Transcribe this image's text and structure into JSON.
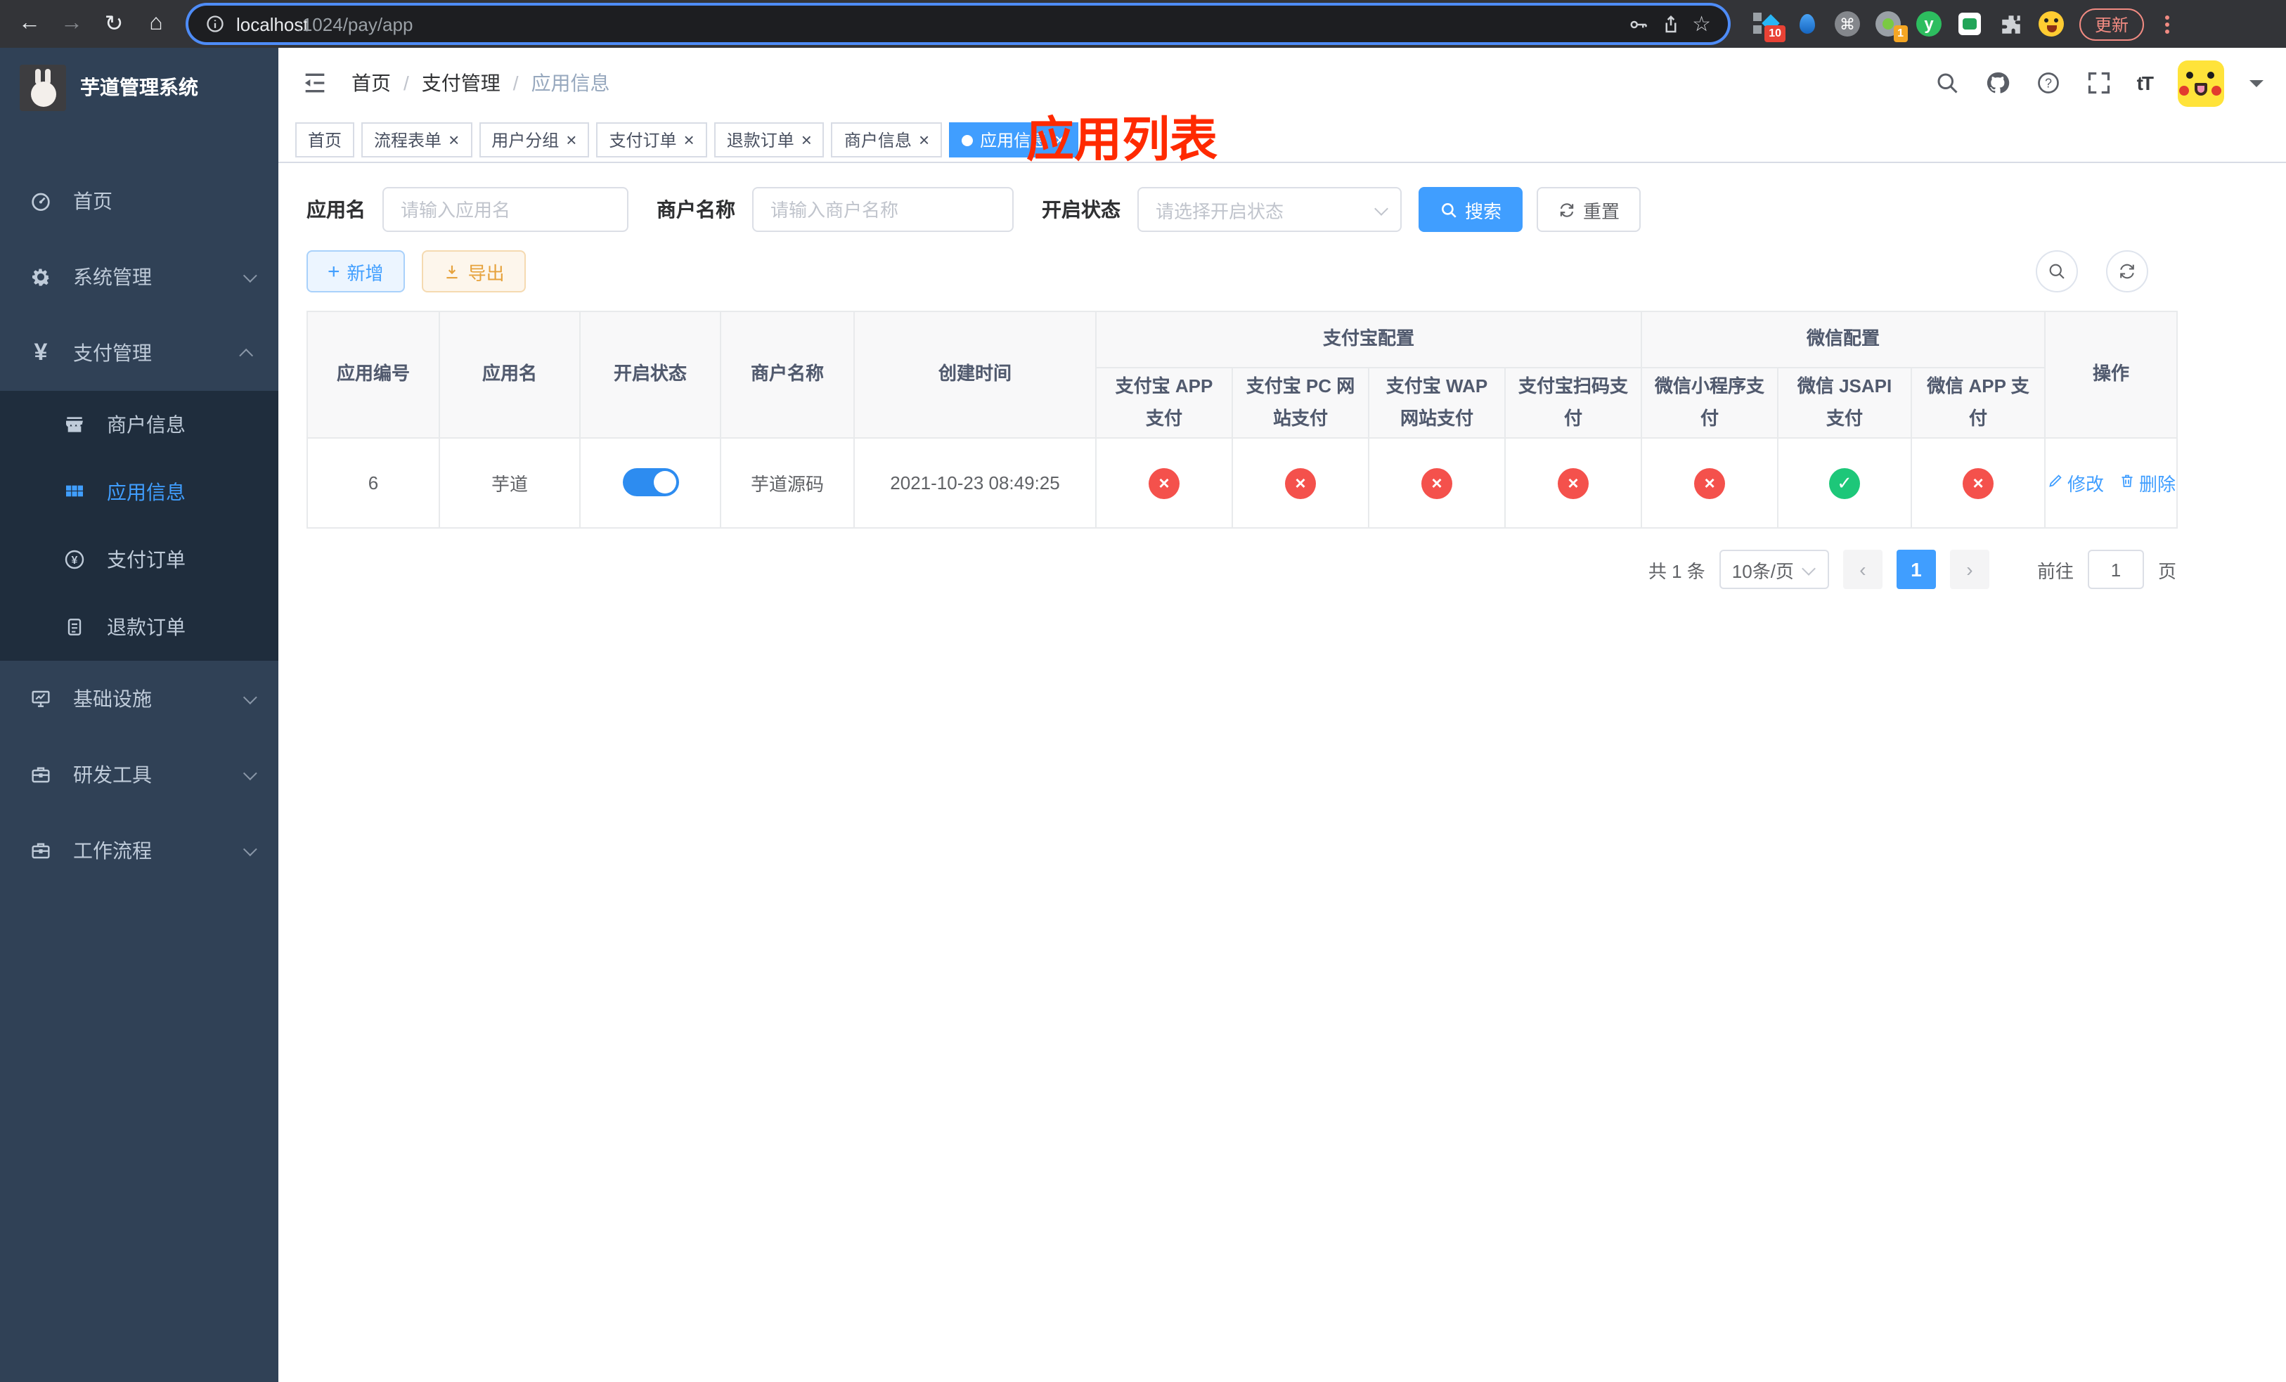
{
  "colors": {
    "accent": "#409eff",
    "danger": "#f4514c",
    "success": "#1dc779",
    "toggle_on": "#2d8cf0",
    "annotation_red": "#ff2a00"
  },
  "browser": {
    "url_host": "localhost",
    "url_rest": ":1024/pay/app",
    "update_label": "更新",
    "ext_badge_blocker": "10",
    "ext_badge_target": "1",
    "ext_yuque_letter": "y"
  },
  "sidebar": {
    "title": "芋道管理系统",
    "menu": [
      {
        "key": "home",
        "icon": "dashboard",
        "label": "首页"
      },
      {
        "key": "system-management",
        "icon": "gear",
        "label": "系统管理",
        "children": [],
        "expanded": false
      },
      {
        "key": "payment-management",
        "icon": "yen",
        "label": "支付管理",
        "expanded": true,
        "children": [
          {
            "key": "merchant-info",
            "icon": "shop",
            "label": "商户信息"
          },
          {
            "key": "app-info",
            "icon": "grid",
            "label": "应用信息",
            "active": true
          },
          {
            "key": "pay-order",
            "icon": "yen-circle",
            "label": "支付订单"
          },
          {
            "key": "refund-order",
            "icon": "document",
            "label": "退款订单"
          }
        ]
      },
      {
        "key": "infrastructure",
        "icon": "monitor",
        "label": "基础设施",
        "children": [],
        "expanded": false
      },
      {
        "key": "dev-tools",
        "icon": "briefcase",
        "label": "研发工具",
        "children": [],
        "expanded": false
      },
      {
        "key": "workflow",
        "icon": "briefcase",
        "label": "工作流程",
        "children": [],
        "expanded": false
      }
    ]
  },
  "navbar": {
    "breadcrumb": [
      "首页",
      "支付管理",
      "应用信息"
    ],
    "font_size_icon_label": "tT"
  },
  "overlay_title": "应用列表",
  "tabs": [
    {
      "key": "home",
      "label": "首页",
      "closable": false,
      "active": false
    },
    {
      "key": "process-form",
      "label": "流程表单",
      "closable": true,
      "active": false
    },
    {
      "key": "user-group",
      "label": "用户分组",
      "closable": true,
      "active": false
    },
    {
      "key": "pay-order",
      "label": "支付订单",
      "closable": true,
      "active": false
    },
    {
      "key": "refund-order",
      "label": "退款订单",
      "closable": true,
      "active": false
    },
    {
      "key": "merchant-info",
      "label": "商户信息",
      "closable": true,
      "active": false
    },
    {
      "key": "app-info",
      "label": "应用信息",
      "closable": true,
      "active": true
    }
  ],
  "filters": {
    "app_name_label": "应用名",
    "app_name_placeholder": "请输入应用名",
    "merchant_label": "商户名称",
    "merchant_placeholder": "请输入商户名称",
    "status_label": "开启状态",
    "status_placeholder": "请选择开启状态",
    "search_label": "搜索",
    "reset_label": "重置"
  },
  "toolbar": {
    "add_label": "新增",
    "export_label": "导出"
  },
  "table": {
    "simple_columns": [
      "应用编号",
      "应用名",
      "开启状态",
      "商户名称",
      "创建时间"
    ],
    "groups": [
      {
        "label": "支付宝配置",
        "children": [
          "支付宝 APP 支付",
          "支付宝 PC 网站支付",
          "支付宝 WAP 网站支付",
          "支付宝扫码支付"
        ]
      },
      {
        "label": "微信配置",
        "children": [
          "微信小程序支付",
          "微信 JSAPI 支付",
          "微信 APP 支付"
        ]
      }
    ],
    "ops_label": "操作",
    "row": {
      "id": "6",
      "name": "芋道",
      "enabled": true,
      "merchant": "芋道源码",
      "created": "2021-10-23 08:49:25",
      "pay_status": [
        "no",
        "no",
        "no",
        "no",
        "no",
        "yes",
        "no"
      ],
      "edit_label": "修改",
      "delete_label": "删除"
    }
  },
  "pagination": {
    "total_text": "共 1 条",
    "page_size_text": "10条/页",
    "current_page": "1",
    "goto_label": "前往",
    "goto_value": "1",
    "page_unit": "页"
  }
}
